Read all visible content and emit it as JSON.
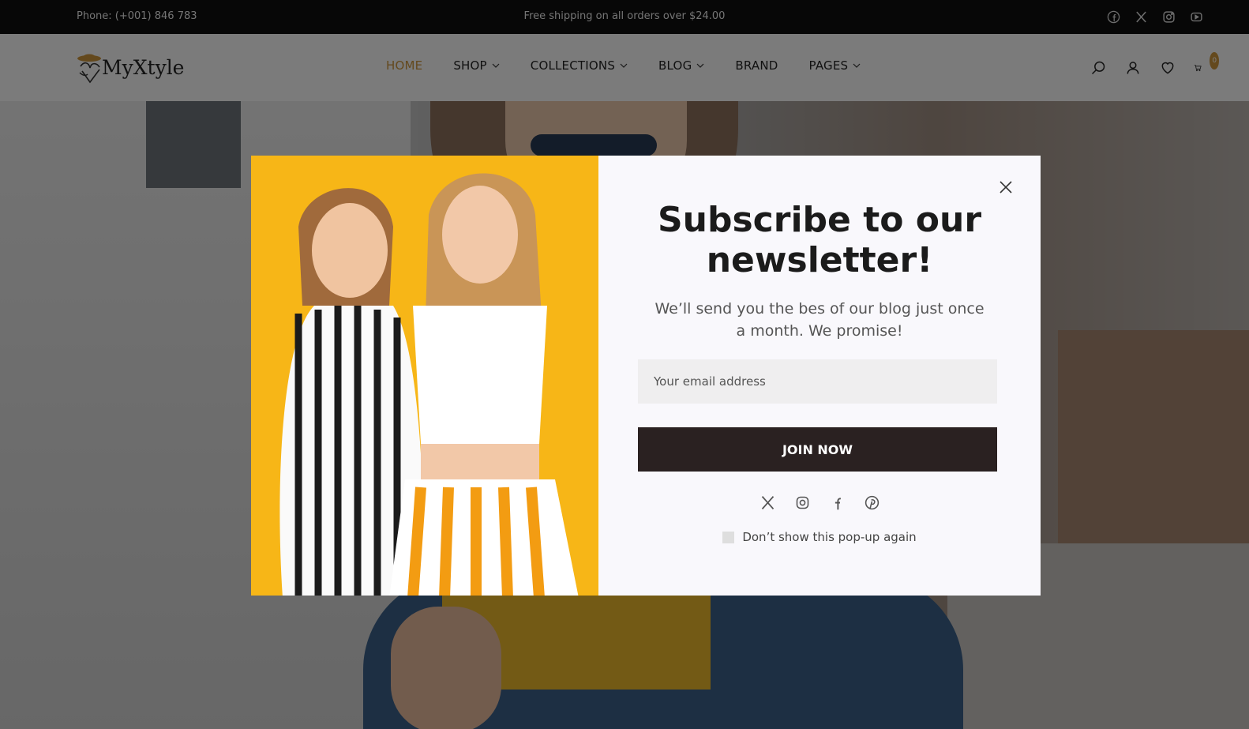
{
  "topbar": {
    "phone": "Phone: (+001) 846 783",
    "shipping": "Free shipping on all orders over $24.00",
    "socials": [
      "facebook-icon",
      "x-icon",
      "instagram-icon",
      "youtube-icon"
    ]
  },
  "header": {
    "logo_text": "MyXtyle",
    "nav": [
      {
        "label": "HOME",
        "active": true,
        "dropdown": false
      },
      {
        "label": "SHOP",
        "dropdown": true
      },
      {
        "label": "COLLECTIONS",
        "dropdown": true
      },
      {
        "label": "BLOG",
        "dropdown": true
      },
      {
        "label": "BRAND",
        "dropdown": false
      },
      {
        "label": "PAGES",
        "dropdown": true
      }
    ],
    "icons": [
      "search-icon",
      "user-icon",
      "heart-icon",
      "cart-icon"
    ],
    "cart_count": "0",
    "accent_color": "#c8923a"
  },
  "popup": {
    "title": "Subscribe to our newsletter!",
    "subtitle": "We’ll send you the bes of our blog just once a month. We promise!",
    "email_placeholder": "Your email address",
    "button_label": "JOIN NOW",
    "socials": [
      "x-icon",
      "instagram-icon",
      "facebook-icon",
      "pinterest-icon"
    ],
    "dont_show_label": "Don’t show this pop-up again",
    "image_bg": "#f7b617",
    "button_color": "#2a2121"
  }
}
